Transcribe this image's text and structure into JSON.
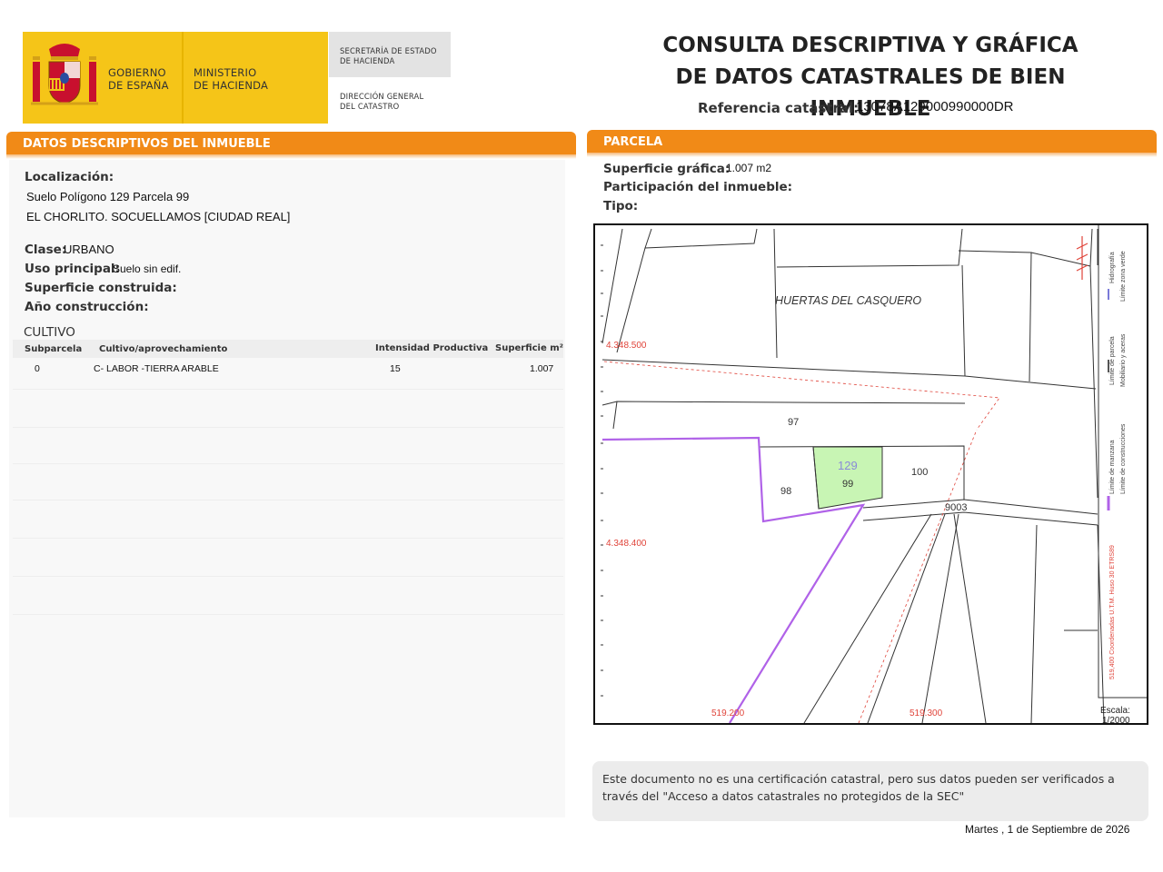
{
  "header": {
    "gov_line1": "GOBIERNO",
    "gov_line2": "DE ESPAÑA",
    "min_line1": "MINISTERIO",
    "min_line2": "DE HACIENDA",
    "sec_line1": "SECRETARÍA DE ESTADO",
    "sec_line2": "DE HACIENDA",
    "dir_line1": "DIRECCIÓN GENERAL",
    "dir_line2": "DEL CATASTRO",
    "title_line1": "CONSULTA DESCRIPTIVA Y GRÁFICA",
    "title_line2": "DE DATOS CATASTRALES DE BIEN INMUEBLE",
    "ref_label": "Referencia catastral:",
    "ref_value": "13078A129000990000DR"
  },
  "left": {
    "section_title": "DATOS DESCRIPTIVOS DEL INMUEBLE",
    "localizacion_label": "Localización:",
    "localizacion_line1": "Suelo Polígono 129 Parcela 99",
    "localizacion_line2": "EL CHORLITO. SOCUELLAMOS [CIUDAD REAL]",
    "clase_label": "Clase:",
    "clase_value": "URBANO",
    "uso_label": "Uso principal:",
    "uso_value": "Suelo sin edif.",
    "sup_construida_label": "Superficie construida:",
    "anio_label": "Año construcción:",
    "cultivo_title": "CULTIVO",
    "table_headers": [
      "Subparcela",
      "Cultivo/aprovechamiento",
      "Intensidad Productiva",
      "Superficie m²"
    ],
    "table_rows": [
      [
        "0",
        "C- LABOR -TIERRA ARABLE",
        "15",
        "1.007"
      ]
    ]
  },
  "right": {
    "section_title": "PARCELA",
    "sup_grafica_label": "Superficie gráfica:",
    "sup_grafica_value": "1.007 m2",
    "participacion_label": "Participación del inmueble:",
    "tipo_label": "Tipo:"
  },
  "map": {
    "area_label": "HUERTAS DEL CASQUERO",
    "parcel_labels": [
      "97",
      "98",
      "100",
      "9003"
    ],
    "highlight_polygon": "129",
    "highlight_parcel": "99",
    "coord_y_top": "4.348.500",
    "coord_y_bottom": "4.348.400",
    "coord_x_left": "519.200",
    "coord_x_right": "519.300",
    "legend_hidrografia": "Hidrografía",
    "legend_limite_zona_verde": "Límite zona verde",
    "legend_limite_parcela": "Límite de parcela",
    "legend_mobiliario": "Mobiliario y aceras",
    "legend_limite_manzana": "Límite de manzana",
    "legend_limite_construcciones": "Límite de construcciones",
    "legend_coords": "519,400 Coordenadas U.T.M. Huso 30 ETRS89",
    "scale_label": "Escala:",
    "scale_value": "1/2000",
    "colors": {
      "highlight_fill": "#c8f5b4",
      "manzana": "#b062e8",
      "coords": "#e0443a"
    }
  },
  "footer": {
    "note": "Este documento no es una certificación catastral, pero sus datos pueden ser verificados a través del \"Acceso a datos catastrales no protegidos de la SEC\"",
    "date": "Martes , 1 de Septiembre de 2026"
  }
}
